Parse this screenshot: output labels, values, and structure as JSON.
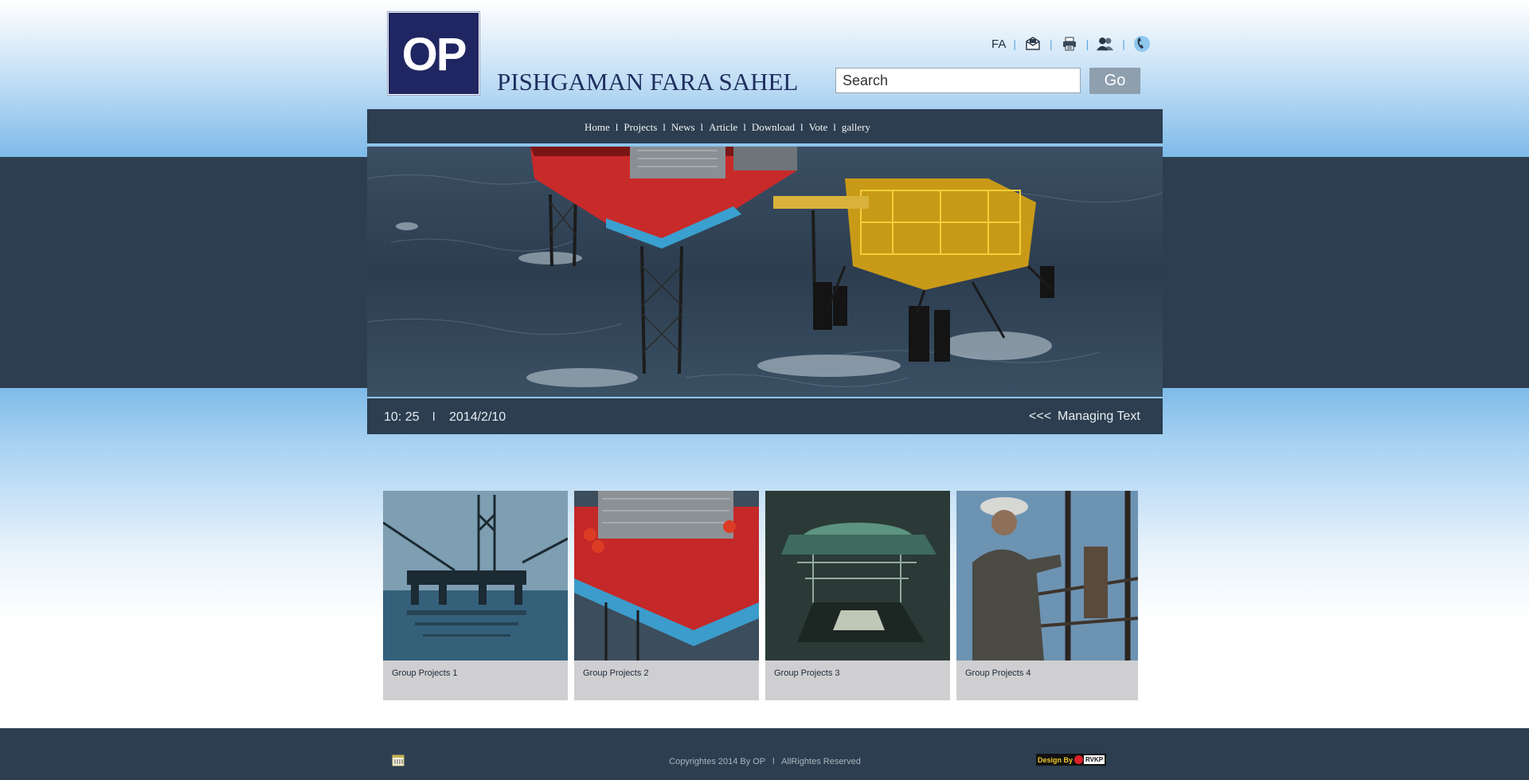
{
  "logo": {
    "text": "OP"
  },
  "brand": {
    "name": "PISHGAMAN FARA SAHEL"
  },
  "toplinks": {
    "language": "FA",
    "icons": [
      "message-icon",
      "print-icon",
      "users-icon",
      "phone-icon"
    ]
  },
  "search": {
    "placeholder": "Search",
    "button": "Go"
  },
  "nav": {
    "items": [
      {
        "label": "Home"
      },
      {
        "label": "Projects"
      },
      {
        "label": "News"
      },
      {
        "label": "Article"
      },
      {
        "label": "Download"
      },
      {
        "label": "Vote"
      },
      {
        "label": "gallery"
      }
    ],
    "separator": "l"
  },
  "hero": {
    "description_icon": "offshore-platform-photo"
  },
  "info_bar": {
    "time": "10: 25",
    "separator": "l",
    "date": "2014/2/10",
    "arrows": "<<<",
    "managing_text": "Managing Text"
  },
  "projects": [
    {
      "caption": "Group Projects 1"
    },
    {
      "caption": "Group Projects 2"
    },
    {
      "caption": "Group Projects 3"
    },
    {
      "caption": "Group Projects 4"
    }
  ],
  "footer": {
    "copyright": "Copyrightes 2014 By OP   l   AllRightes Reserved",
    "design_by": "Design By",
    "designer": "RVKP"
  },
  "colors": {
    "navy": "#2c3e50",
    "logo_blue": "#1f2661",
    "accent_blue": "#8fc7ee",
    "go_button": "#8e9fae"
  }
}
